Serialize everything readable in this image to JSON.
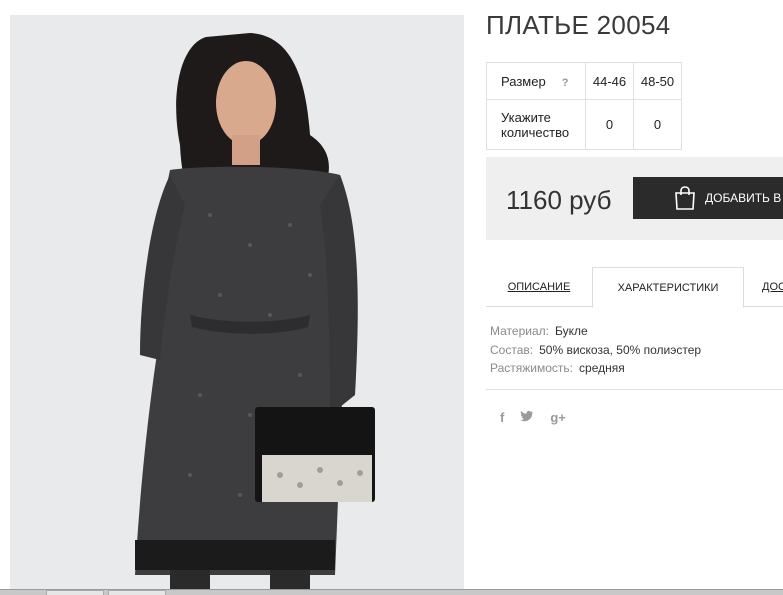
{
  "product": {
    "title": "ПЛАТЬЕ 20054",
    "image_alt": "dress photo"
  },
  "sizes": {
    "size_label": "Размер",
    "help": "?",
    "options": [
      "44-46",
      "48-50"
    ],
    "qty_label_line1": "Укажите",
    "qty_label_line2": "количество",
    "quantities": [
      "0",
      "0"
    ]
  },
  "price": {
    "value": "1160 руб",
    "add_to_cart": "ДОБАВИТЬ В З"
  },
  "tabs": [
    {
      "label": "ОПИСАНИЕ",
      "active": false
    },
    {
      "label": "ХАРАКТЕРИСТИКИ",
      "active": true
    },
    {
      "label": "ДОС",
      "active": false
    }
  ],
  "characteristics": [
    {
      "key": "Материал:",
      "value": "Букле"
    },
    {
      "key": "Состав:",
      "value": "50% вискоза, 50% полиэстер"
    },
    {
      "key": "Растяжимость:",
      "value": "средняя"
    }
  ],
  "social": {
    "facebook": "f",
    "twitter": "t",
    "google": "g+"
  },
  "colors": {
    "button_bg": "#2b2b2b",
    "price_bg": "#efefef",
    "photo_bg": "#e9eaec"
  }
}
